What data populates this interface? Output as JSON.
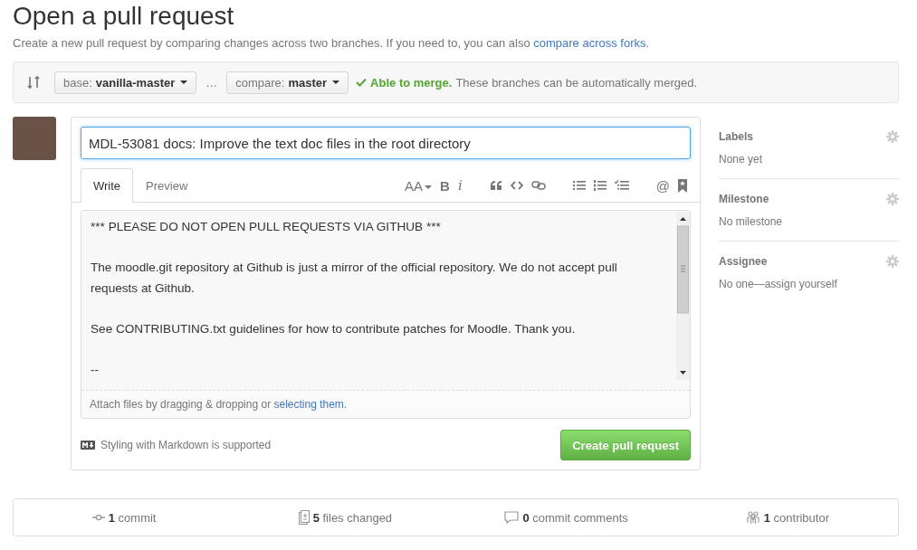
{
  "page": {
    "title": "Open a pull request",
    "subtitle": "Create a new pull request by comparing changes across two branches. If you need to, you can also",
    "subtitle_link": "compare across forks",
    "subtitle_end": "."
  },
  "range": {
    "base_label": "base:",
    "base_value": "vanilla-master",
    "separator": "…",
    "compare_label": "compare:",
    "compare_value": "master",
    "status_title": "Able to merge.",
    "status_text": "These branches can be automatically merged."
  },
  "form": {
    "title_value": "MDL-53081 docs: Improve the text doc files in the root directory",
    "tabs": [
      {
        "label": "Write",
        "selected": true
      },
      {
        "label": "Preview",
        "selected": false
      }
    ],
    "toolbar": {
      "header_glyph": "AA",
      "bold_glyph": "B",
      "italic_glyph": "i",
      "mention_glyph": "@"
    },
    "body_paragraphs": [
      "*** PLEASE DO NOT OPEN PULL REQUESTS VIA GITHUB ***",
      "The moodle.git repository at Github is just a mirror of the official repository. We do not accept pull requests at Github.",
      "See CONTRIBUTING.txt guidelines for how to contribute patches for Moodle. Thank you.",
      "--"
    ],
    "attach_text": "Attach files by dragging & dropping or",
    "attach_link": "selecting them",
    "attach_end": ".",
    "markdown_note": "Styling with Markdown is supported",
    "submit": "Create pull request"
  },
  "sidebar": [
    {
      "heading": "Labels",
      "value": "None yet"
    },
    {
      "heading": "Milestone",
      "value": "No milestone"
    },
    {
      "heading": "Assignee",
      "value": "No one—assign yourself"
    }
  ],
  "summary": [
    {
      "kind": "commits",
      "text": "**1** commit"
    },
    {
      "kind": "files",
      "text": "**5** files changed"
    },
    {
      "kind": "comments",
      "text": "**0** commit comments"
    },
    {
      "kind": "contributors",
      "text": "**1** contributor"
    }
  ]
}
